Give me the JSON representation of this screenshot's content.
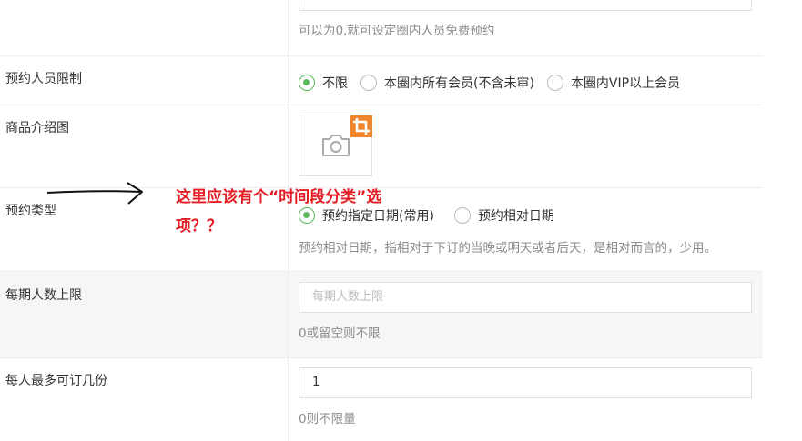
{
  "header_field": {
    "value": "…",
    "help": "可以为0,就可设定圈内人员免费预约"
  },
  "booking_restriction": {
    "label": "预约人员限制",
    "options": [
      "不限",
      "本圈内所有会员(不含未审)",
      "本圈内VIP以上会员"
    ],
    "selected": "不限"
  },
  "product_image": {
    "label": "商品介绍图",
    "camera_icon": "camera-icon",
    "crop_icon": "crop-icon",
    "crop_color": "#f0852b"
  },
  "booking_type": {
    "label": "预约类型",
    "options": [
      "预约指定日期(常用)",
      "预约相对日期"
    ],
    "selected": "预约指定日期(常用)",
    "help": "预约相对日期，指相对于下订的当晚或明天或者后天，是相对而言的，少用。"
  },
  "annotation": {
    "line1": "这里应该有个“时间段分类”选",
    "line2": "项？？",
    "color": "#e51c23"
  },
  "capacity": {
    "label": "每期人数上限",
    "placeholder": "每期人数上限",
    "help": "0或留空则不限"
  },
  "max_per_person": {
    "label": "每人最多可订几份",
    "value": "1",
    "help": "0则不限量"
  },
  "colors": {
    "accent": "#5cb85c",
    "help_text": "#8c8c8c"
  }
}
